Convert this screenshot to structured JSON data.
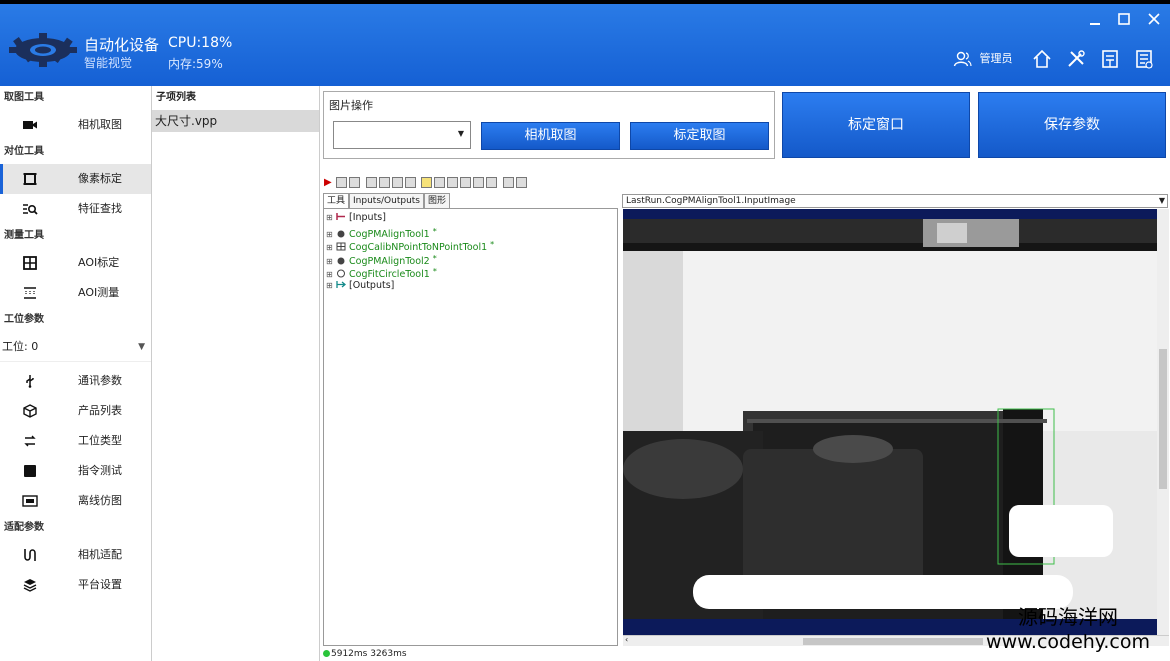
{
  "header": {
    "app_name": "自动化设备",
    "app_sub": "智能视觉",
    "cpu": "CPU:18%",
    "mem": "内存:59%",
    "user": "管理员"
  },
  "nav": {
    "sections": {
      "capture": "取图工具",
      "align": "对位工具",
      "measure": "测量工具",
      "station": "工位参数",
      "adapt": "适配参数"
    },
    "items": {
      "camera_capture": "相机取图",
      "pixel_calibration": "像素标定",
      "feature_search": "特征查找",
      "aoi_calibration": "AOI标定",
      "aoi_measure": "AOI测量",
      "comm_params": "通讯参数",
      "product_list": "产品列表",
      "station_type": "工位类型",
      "command_test": "指令测试",
      "offline_sim": "离线仿图",
      "camera_adapt": "相机适配",
      "platform_settings": "平台设置"
    },
    "station_select": "工位:  0"
  },
  "sublist": {
    "title": "子项列表",
    "item": "大尺寸.vpp"
  },
  "image_ops": {
    "title": "图片操作",
    "combo_value": "",
    "camera_capture": "相机取图",
    "calib_capture": "标定取图"
  },
  "actions": {
    "calib_window": "标定窗口",
    "save_params": "保存参数"
  },
  "vision": {
    "tabs": [
      "工具",
      "Inputs/Outputs",
      "图形"
    ],
    "tree": {
      "inputs": "[Inputs]",
      "tool1": "CogPMAlignTool1",
      "tool2": "CogCalibNPointToNPointTool1",
      "tool3": "CogPMAlignTool2",
      "tool4": "CogFitCircleTool1",
      "outputs": "[Outputs]"
    },
    "image_selector": "LastRun.CogPMAlignTool1.InputImage",
    "status_text": "5912ms 3263ms"
  },
  "watermark": {
    "cn": "源码海洋网",
    "url": "www.codehy.com"
  },
  "colors": {
    "title_bar": "#1f6fe0",
    "button_blue": "#1a63d8",
    "tool_green": "#1a8a1a"
  }
}
